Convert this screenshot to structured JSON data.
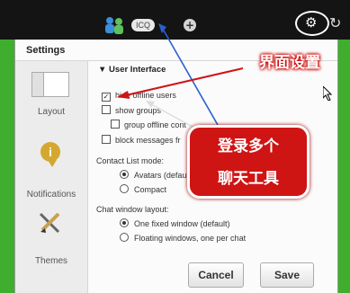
{
  "topbar": {
    "app_badge": "ICQ",
    "add_icon": "plus-icon",
    "settings_icon": "gear-icon",
    "power_icon": "power-icon"
  },
  "window": {
    "title": "Settings"
  },
  "sidebar": {
    "items": [
      {
        "label": "Layout",
        "icon": "layout-icon"
      },
      {
        "label": "Notifications",
        "icon": "info-bubble-icon"
      },
      {
        "label": "Themes",
        "icon": "paintbrush-icon"
      }
    ]
  },
  "user_interface": {
    "section_title": "User Interface",
    "hide_offline_users": "hide offline users",
    "show_groups": "show groups",
    "group_offline_contacts": "group offline cont",
    "block_messages": "block messages fr",
    "contact_list_mode_label": "Contact List mode:",
    "contact_list_modes": [
      "Avatars (defau",
      "Compact"
    ],
    "chat_window_layout_label": "Chat window layout:",
    "chat_window_layouts": [
      "One fixed window (default)",
      "Floating windows, one per chat"
    ]
  },
  "buttons": {
    "cancel": "Cancel",
    "save": "Save"
  },
  "annotations": {
    "ui_settings": "界面设置",
    "login_multi": "登录多个",
    "chat_tools": "聊天工具"
  },
  "colors": {
    "background_green": "#3fae2f",
    "annotation_red": "#cf1414",
    "dark_bar": "#141414"
  }
}
